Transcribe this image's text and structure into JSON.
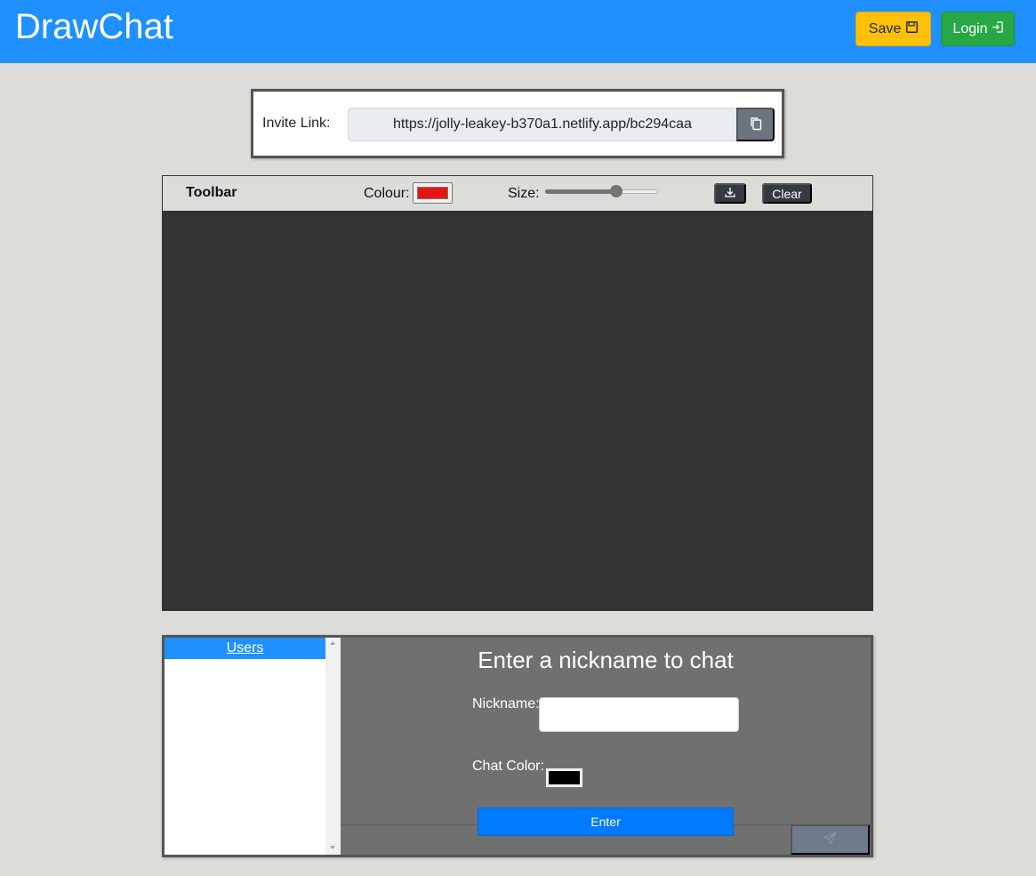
{
  "header": {
    "brand": "DrawChat",
    "save_label": "Save",
    "login_label": "Login"
  },
  "invite": {
    "label": "Invite Link:",
    "url": "https://jolly-leakey-b370a1.netlify.app/bc294caa"
  },
  "toolbar": {
    "title": "Toolbar",
    "colour_label": "Colour:",
    "colour_value": "#e81414",
    "size_label": "Size:",
    "size_fraction": 0.65,
    "clear_label": "Clear"
  },
  "chat": {
    "users_heading": "Users",
    "title": "Enter a nickname to chat",
    "nickname_label": "Nickname:",
    "nickname_value": "",
    "chat_color_label": "Chat Color:",
    "chat_color_value": "#000000",
    "enter_label": "Enter"
  },
  "icons": {
    "save": "floppy-disk-icon",
    "login": "login-icon",
    "copy": "copy-icon",
    "download": "download-icon",
    "send": "send-icon"
  },
  "colors": {
    "navbar": "#1e90ff",
    "save": "#ffc107",
    "login": "#28a745",
    "canvas": "#333333",
    "enter": "#007bff"
  }
}
